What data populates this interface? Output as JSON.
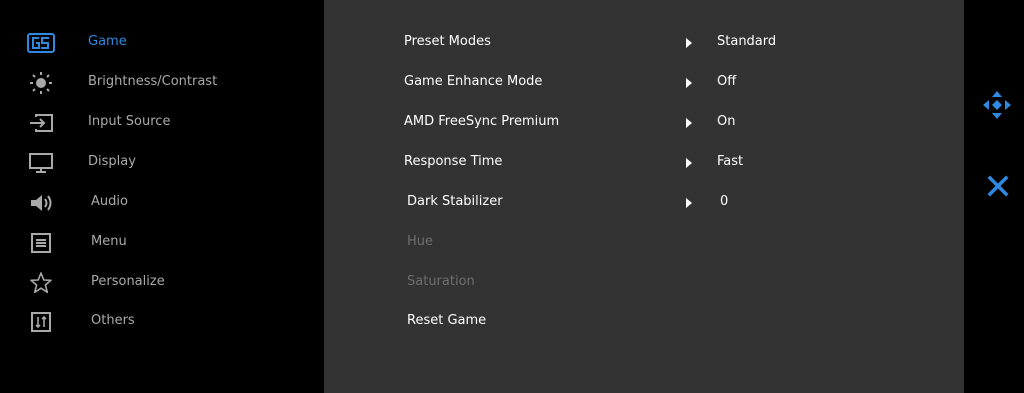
{
  "sidebar": {
    "items": [
      {
        "label": "Game",
        "icon": "game-icon",
        "active": true
      },
      {
        "label": "Brightness/Contrast",
        "icon": "brightness-icon"
      },
      {
        "label": "Input Source",
        "icon": "input-source-icon"
      },
      {
        "label": "Display",
        "icon": "display-icon"
      },
      {
        "label": "Audio",
        "icon": "speaker-icon"
      },
      {
        "label": "Menu",
        "icon": "menu-icon"
      },
      {
        "label": "Personalize",
        "icon": "star-icon"
      },
      {
        "label": "Others",
        "icon": "others-icon"
      }
    ]
  },
  "panel": {
    "rows": [
      {
        "name": "Preset Modes",
        "value": "Standard"
      },
      {
        "name": "Game Enhance Mode",
        "value": "Off"
      },
      {
        "name": "AMD FreeSync Premium",
        "value": "On"
      },
      {
        "name": "Response Time",
        "value": "Fast"
      },
      {
        "name": "Dark Stabilizer",
        "value": "0"
      },
      {
        "name": "Hue",
        "disabled": true
      },
      {
        "name": "Saturation",
        "disabled": true
      },
      {
        "name": "Reset Game"
      }
    ]
  },
  "controls": {
    "nav_icon": "navigate-icon",
    "close_icon": "close-icon"
  },
  "colors": {
    "accent": "#2f89e1",
    "panel": "#333333",
    "background": "#000000",
    "disabled_text": "#6e6e6e"
  }
}
